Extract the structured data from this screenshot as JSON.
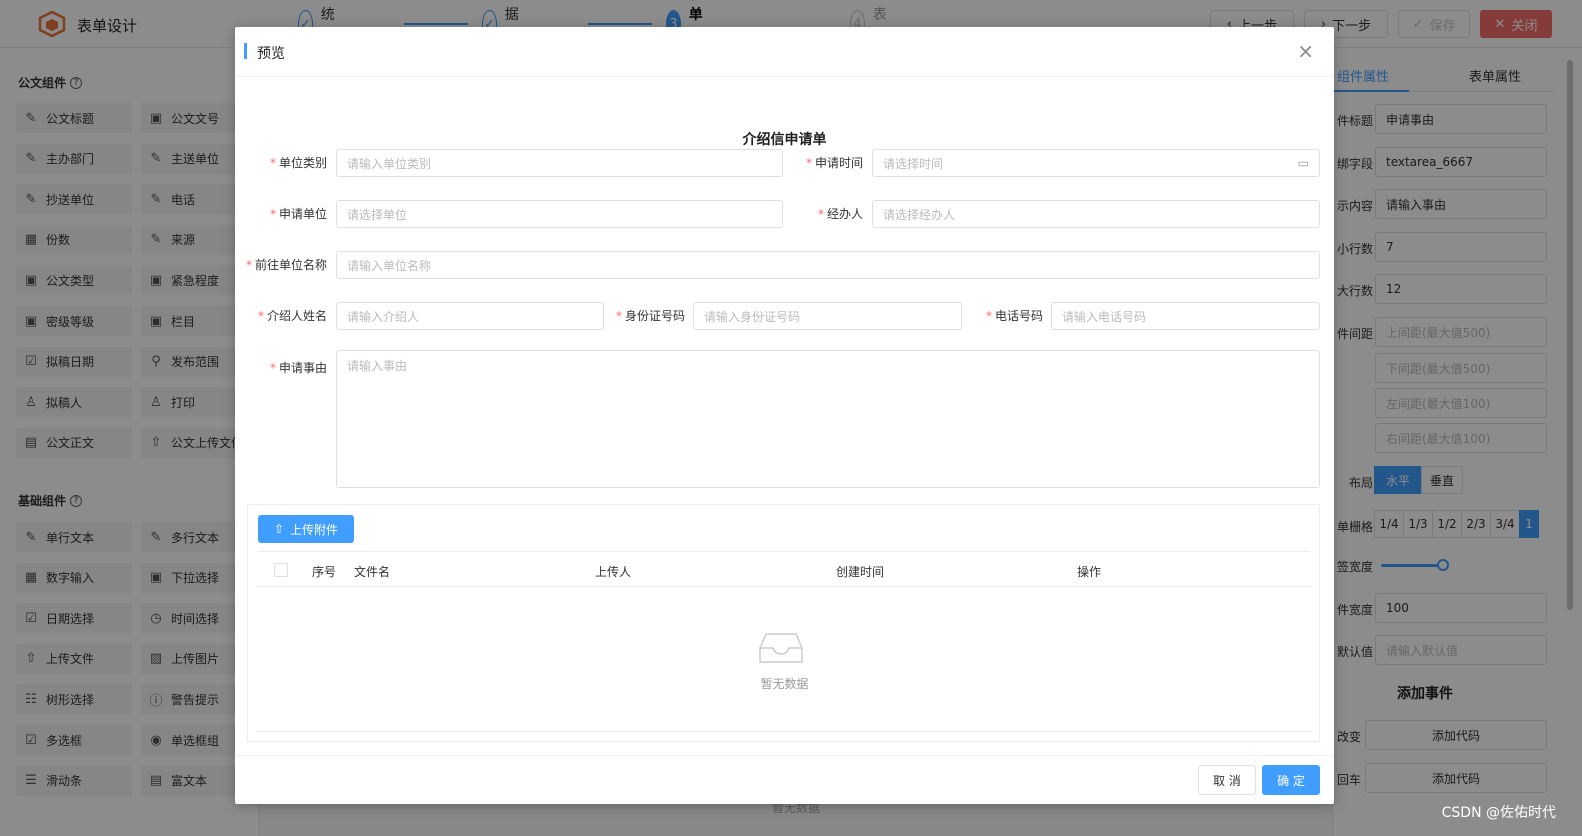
{
  "app": {
    "title": "表单设计",
    "steps": [
      {
        "num": "✓",
        "label": "系统配置",
        "state": "done"
      },
      {
        "num": "✓",
        "label": "数据配置",
        "state": "done"
      },
      {
        "num": "3",
        "label": "表单设计",
        "state": "active"
      },
      {
        "num": "4",
        "label": "列表设计",
        "state": "wait"
      }
    ],
    "buttons": {
      "prev": "上一步",
      "next": "下一步",
      "save": "保存",
      "close": "关闭"
    }
  },
  "left_panel": {
    "group1_title": "公文组件",
    "group1": [
      {
        "icon": "✎",
        "label": "公文标题"
      },
      {
        "icon": "▣",
        "label": "公文文号"
      },
      {
        "icon": "✎",
        "label": "主办部门"
      },
      {
        "icon": "✎",
        "label": "主送单位"
      },
      {
        "icon": "✎",
        "label": "抄送单位"
      },
      {
        "icon": "✎",
        "label": "电话"
      },
      {
        "icon": "▦",
        "label": "份数"
      },
      {
        "icon": "✎",
        "label": "来源"
      },
      {
        "icon": "▣",
        "label": "公文类型"
      },
      {
        "icon": "▣",
        "label": "紧急程度"
      },
      {
        "icon": "▣",
        "label": "密级等级"
      },
      {
        "icon": "▣",
        "label": "栏目"
      },
      {
        "icon": "☑",
        "label": "拟稿日期"
      },
      {
        "icon": "⚲",
        "label": "发布范围"
      },
      {
        "icon": "♙",
        "label": "拟稿人"
      },
      {
        "icon": "♙",
        "label": "打印"
      },
      {
        "icon": "▤",
        "label": "公文正文"
      },
      {
        "icon": "⇧",
        "label": "公文上传文件"
      }
    ],
    "group2_title": "基础组件",
    "group2": [
      {
        "icon": "✎",
        "label": "单行文本"
      },
      {
        "icon": "✎",
        "label": "多行文本"
      },
      {
        "icon": "▦",
        "label": "数字输入"
      },
      {
        "icon": "▣",
        "label": "下拉选择"
      },
      {
        "icon": "☑",
        "label": "日期选择"
      },
      {
        "icon": "◷",
        "label": "时间选择"
      },
      {
        "icon": "⇧",
        "label": "上传文件"
      },
      {
        "icon": "▨",
        "label": "上传图片"
      },
      {
        "icon": "☷",
        "label": "树形选择"
      },
      {
        "icon": "ⓘ",
        "label": "警告提示"
      },
      {
        "icon": "☑",
        "label": "多选框"
      },
      {
        "icon": "◉",
        "label": "单选框组"
      },
      {
        "icon": "☰",
        "label": "滑动条"
      },
      {
        "icon": "▤",
        "label": "富文本"
      }
    ]
  },
  "middle": {
    "empty_text": "暂无数据"
  },
  "right_panel": {
    "tabs": [
      "组件属性",
      "表单属性"
    ],
    "fields": [
      {
        "label": "件标题",
        "value": "申请事由",
        "ph": false
      },
      {
        "label": "绑字段",
        "value": "textarea_6667",
        "ph": false
      },
      {
        "label": "示内容",
        "value": "请输入事由",
        "ph": false
      },
      {
        "label": "小行数",
        "value": "7",
        "ph": false
      },
      {
        "label": "大行数",
        "value": "12",
        "ph": false
      },
      {
        "label": "件间距",
        "value": "上间距(最大值500)",
        "ph": true
      },
      {
        "label": "",
        "value": "下间距(最大值500)",
        "ph": true
      },
      {
        "label": "",
        "value": "左间距(最大值100)",
        "ph": true
      },
      {
        "label": "",
        "value": "右间距(最大值100)",
        "ph": true
      }
    ],
    "layout_label": "布局",
    "layout_options": [
      "水平",
      "垂直"
    ],
    "grid_label": "单栅格",
    "grid_options": [
      "1/4",
      "1/3",
      "1/2",
      "2/3",
      "3/4",
      "1"
    ],
    "label_width_label": "签宽度",
    "label_width_value": 0.3,
    "comp_width_label": "件宽度",
    "comp_width_value": "100",
    "default_label": "默认值",
    "default_ph": "请输入默认值",
    "events_title": "添加事件",
    "events": [
      {
        "label": "改变",
        "button": "添加代码"
      },
      {
        "label": "回车",
        "button": "添加代码"
      }
    ]
  },
  "watermark": "CSDN @佐佑时代",
  "dialog": {
    "title": "预览",
    "close_icon": "×",
    "form_title": "介绍信申请单",
    "fields": {
      "unit_type": {
        "label": "单位类别",
        "placeholder": "请输入单位类别"
      },
      "apply_time": {
        "label": "申请时间",
        "placeholder": "请选择时间"
      },
      "apply_unit": {
        "label": "申请单位",
        "placeholder": "请选择单位"
      },
      "handler": {
        "label": "经办人",
        "placeholder": "请选择经办人"
      },
      "target_unit": {
        "label": "前往单位名称",
        "placeholder": "请输入单位名称"
      },
      "introducer": {
        "label": "介绍人姓名",
        "placeholder": "请输入介绍人"
      },
      "id_number": {
        "label": "身份证号码",
        "placeholder": "请输入身份证号码"
      },
      "phone": {
        "label": "电话号码",
        "placeholder": "请输入电话号码"
      },
      "reason": {
        "label": "申请事由",
        "placeholder": "请输入事由"
      }
    },
    "attachments": {
      "upload_label": "上传附件",
      "columns": [
        "序号",
        "文件名",
        "上传人",
        "创建时间",
        "操作"
      ],
      "empty_text": "暂无数据"
    },
    "footer": {
      "cancel": "取 消",
      "ok": "确 定"
    }
  }
}
